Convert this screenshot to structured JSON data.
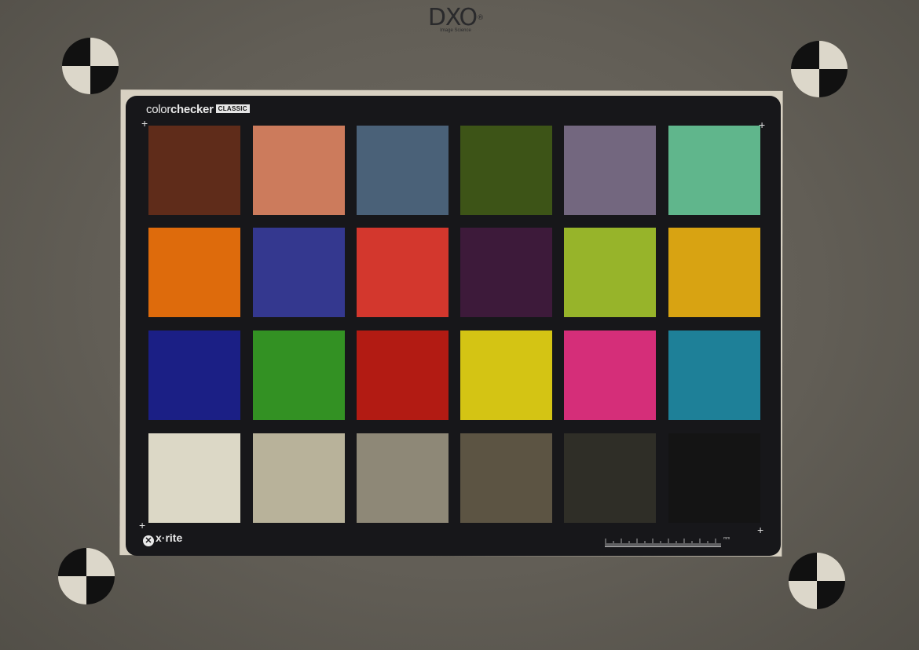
{
  "logo": {
    "main": "DXO",
    "reg": "®",
    "sub": "Image Science"
  },
  "brand": {
    "light": "color",
    "bold": "checker",
    "badge": "CLASSIC"
  },
  "footer": {
    "mark": "✕",
    "text": "x·rite"
  },
  "ruler_unit": "mm",
  "patches": [
    [
      "#5f2c1a",
      "#cc7b5c",
      "#4a6178",
      "#3d5417",
      "#73677f",
      "#60b68c"
    ],
    [
      "#de6b0c",
      "#34388f",
      "#d3372d",
      "#3d1a3a",
      "#97b42a",
      "#d8a312"
    ],
    [
      "#1b1f85",
      "#339123",
      "#b21b13",
      "#d4c414",
      "#d52e79",
      "#1e8098"
    ],
    [
      "#dcd8c6",
      "#b8b29a",
      "#8e8877",
      "#5c5443",
      "#2f2e27",
      "#141414"
    ]
  ]
}
